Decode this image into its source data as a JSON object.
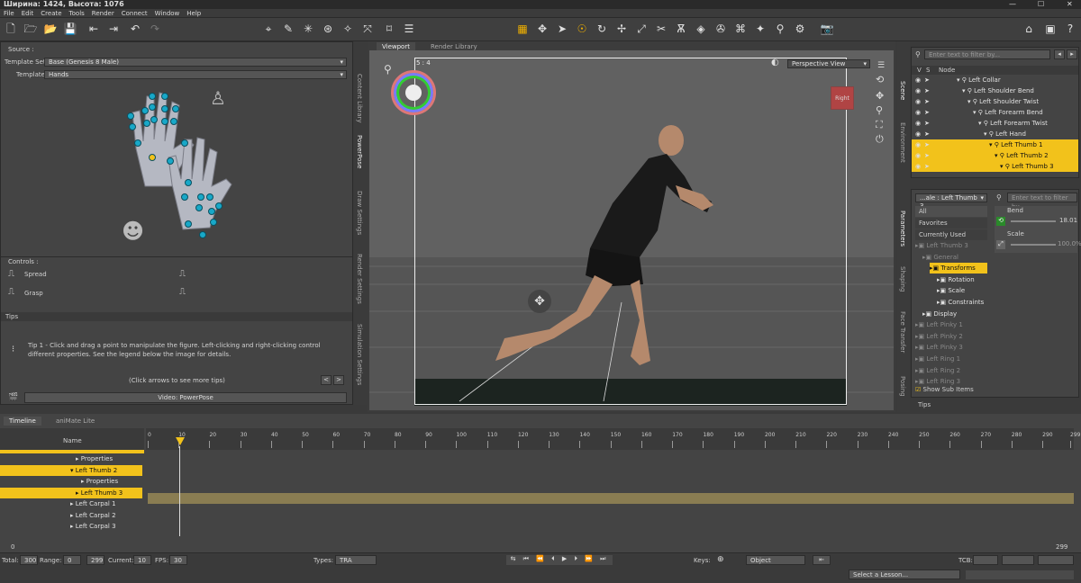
{
  "title": "Ширина: 1424, Высота: 1076",
  "menu": [
    "File",
    "Edit",
    "Create",
    "Tools",
    "Render",
    "Connect",
    "Window",
    "Help"
  ],
  "left": {
    "source_label": "Source :",
    "template_set_label": "Template Set :",
    "template_set_value": "Base (Genesis 8 Male)",
    "template_label": "Template :",
    "template_value": "Hands",
    "controls_label": "Controls :",
    "spread": "Spread",
    "grasp": "Grasp",
    "tips_label": "Tips",
    "tip_text": "Tip 1 - Click and drag a point to manipulate the figure. Left-clicking and right-clicking control different properties. See the legend below the image for details.",
    "click_arrows": "(Click arrows to see more tips)",
    "video": "Video: PowerPose"
  },
  "vtabs_left": [
    "Content Library",
    "PowerPose",
    "Draw Settings",
    "Render Settings",
    "Simulation Settings"
  ],
  "viewport": {
    "tab_viewport": "Viewport",
    "tab_render": "Render Library",
    "view_mode": "Perspective View",
    "frame_label": "5 : 4",
    "cube_label": "Right"
  },
  "scene": {
    "search_placeholder": "Enter text to filter by...",
    "col_v": "V",
    "col_s": "S",
    "col_node": "Node",
    "nodes": [
      {
        "label": "Left Collar",
        "indent": 0,
        "sel": false
      },
      {
        "label": "Left Shoulder Bend",
        "indent": 1,
        "sel": false
      },
      {
        "label": "Left Shoulder Twist",
        "indent": 2,
        "sel": false
      },
      {
        "label": "Left Forearm Bend",
        "indent": 3,
        "sel": false
      },
      {
        "label": "Left Forearm Twist",
        "indent": 4,
        "sel": false
      },
      {
        "label": "Left Hand",
        "indent": 5,
        "sel": false
      },
      {
        "label": "Left Thumb 1",
        "indent": 6,
        "sel": true
      },
      {
        "label": "Left Thumb 2",
        "indent": 7,
        "sel": true
      },
      {
        "label": "Left Thumb 3",
        "indent": 8,
        "sel": true
      }
    ]
  },
  "params": {
    "node_select": "...ale : Left Thumb 3",
    "search_placeholder": "Enter text to filter by...",
    "cats": [
      "All",
      "Favorites",
      "Currently Used"
    ],
    "tree": [
      {
        "label": "Left Thumb 3",
        "indent": 0,
        "dim": true,
        "sel": false
      },
      {
        "label": "General",
        "indent": 1,
        "dim": true,
        "sel": false
      },
      {
        "label": "Transforms",
        "indent": 2,
        "dim": false,
        "sel": true
      },
      {
        "label": "Rotation",
        "indent": 3,
        "dim": false,
        "sel": false
      },
      {
        "label": "Scale",
        "indent": 3,
        "dim": false,
        "sel": false
      },
      {
        "label": "Constraints",
        "indent": 3,
        "dim": false,
        "sel": false
      },
      {
        "label": "Display",
        "indent": 1,
        "dim": false,
        "sel": false
      },
      {
        "label": "Left Pinky 1",
        "indent": 0,
        "dim": true,
        "sel": false
      },
      {
        "label": "Left Pinky 2",
        "indent": 0,
        "dim": true,
        "sel": false
      },
      {
        "label": "Left Pinky 3",
        "indent": 0,
        "dim": true,
        "sel": false
      },
      {
        "label": "Left Ring 1",
        "indent": 0,
        "dim": true,
        "sel": false
      },
      {
        "label": "Left Ring 2",
        "indent": 0,
        "dim": true,
        "sel": false
      },
      {
        "label": "Left Ring 3",
        "indent": 0,
        "dim": true,
        "sel": false
      }
    ],
    "show_sub": "Show Sub Items",
    "bend_label": "Bend",
    "bend_value": "18.01",
    "scale_label": "Scale",
    "scale_value": "100.0%",
    "tips": "Tips"
  },
  "vtabs_right": [
    "Scene",
    "Environment",
    "Parameters",
    "Shaping",
    "Face Transfer",
    "Posing"
  ],
  "timeline": {
    "tab1": "Timeline",
    "tab2": "aniMate Lite",
    "name_col": "Name",
    "ticks": [
      "0",
      "10",
      "20",
      "30",
      "40",
      "50",
      "60",
      "70",
      "80",
      "90",
      "100",
      "110",
      "120",
      "130",
      "140",
      "150",
      "160",
      "170",
      "180",
      "190",
      "200",
      "210",
      "220",
      "230",
      "240",
      "250",
      "260",
      "270",
      "280",
      "290",
      "299"
    ],
    "rows": [
      {
        "label": "Properties",
        "indent": 1,
        "sel": false,
        "prefix": "▸"
      },
      {
        "label": "Left Thumb 2",
        "indent": 0,
        "sel": true,
        "prefix": "▾"
      },
      {
        "label": "Properties",
        "indent": 2,
        "sel": false,
        "prefix": "▸"
      },
      {
        "label": "Left Thumb 3",
        "indent": 1,
        "sel": true,
        "prefix": "▸"
      },
      {
        "label": "Left Carpal 1",
        "indent": 0,
        "sel": false,
        "prefix": "▸"
      },
      {
        "label": "Left Carpal 2",
        "indent": 0,
        "sel": false,
        "prefix": "▸"
      },
      {
        "label": "Left Carpal 3",
        "indent": 0,
        "sel": false,
        "prefix": "▸"
      }
    ],
    "range_start": "0",
    "range_end": "299"
  },
  "status": {
    "total_label": "Total:",
    "total": "300",
    "range_label": "Range:",
    "range_from": "0",
    "range_to": "299",
    "current_label": "Current:",
    "current": "10",
    "fps_label": "FPS:",
    "fps": "30",
    "types_label": "Types:",
    "types": "TRA",
    "keys_label": "Keys:",
    "object": "Object",
    "tcb": "TCB:"
  },
  "lesson": "Select a Lesson..."
}
